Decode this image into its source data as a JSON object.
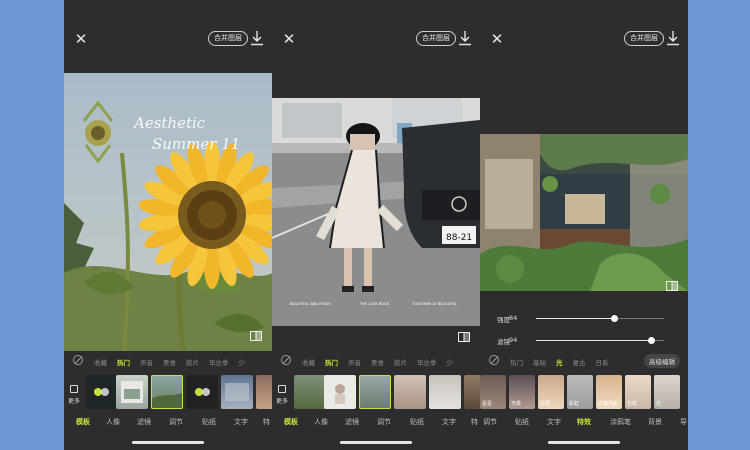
{
  "colors": {
    "accent": "#c6e33a",
    "panel_bg": "#2d2d2d",
    "page_bg": "#6f98d6"
  },
  "panels": [
    {
      "merge_label": "合并图层",
      "photo_script_text": [
        "Aesthetic",
        "Summer 11"
      ],
      "categories": [
        "收藏",
        "热门",
        "声音",
        "美食",
        "胶片",
        "毕业季",
        "少"
      ],
      "active_category": 1,
      "more_label": "更多",
      "thumbs": [
        "",
        "",
        "",
        "",
        "",
        ""
      ],
      "tabs": [
        "模板",
        "人像",
        "滤镜",
        "调节",
        "贴纸",
        "文字",
        "特"
      ],
      "active_tab": 0
    },
    {
      "merge_label": "合并图层",
      "plate_text": "88-21",
      "caption_left": "BEAUTIFUL AND FRESH",
      "caption_mid": "THE LOOK BOOK",
      "caption_right": "TOGETHER AT BEAUTIFUL",
      "categories": [
        "收藏",
        "热门",
        "声音",
        "美食",
        "胶片",
        "毕业季",
        "少"
      ],
      "active_category": 1,
      "more_label": "更多",
      "thumbs": [
        "",
        "",
        "",
        "",
        "",
        ""
      ],
      "tabs": [
        "模板",
        "人像",
        "滤镜",
        "调节",
        "贴纸",
        "文字",
        "特"
      ],
      "active_tab": 0
    },
    {
      "merge_label": "合并图层",
      "sliders": [
        {
          "label": "强度",
          "value": "84",
          "level": 0.61
        },
        {
          "label": "滤镜",
          "value": "94",
          "level": 0.9
        }
      ],
      "categories": [
        "热门",
        "基础",
        "光",
        "复古",
        "日系"
      ],
      "active_category": 2,
      "advanced_label": "高级编辑",
      "thumbs": [
        "星星",
        "光晕",
        "光斑",
        "彩虹",
        "日落光影",
        "光效",
        "光"
      ],
      "tabs": [
        "调节",
        "贴纸",
        "文字",
        "特效",
        "涂鸦笔",
        "背景",
        "导"
      ],
      "active_tab": 3
    }
  ]
}
